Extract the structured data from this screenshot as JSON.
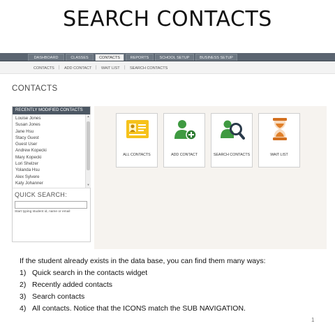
{
  "slide": {
    "title": "SEARCH CONTACTS",
    "page_number": "1"
  },
  "app": {
    "top_nav": [
      {
        "label": "DASHBOARD",
        "active": false
      },
      {
        "label": "CLASSES",
        "active": false
      },
      {
        "label": "CONTACTS",
        "active": true
      },
      {
        "label": "REPORTS",
        "active": false
      },
      {
        "label": "SCHOOL SETUP",
        "active": false
      },
      {
        "label": "BUSINESS SETUP",
        "active": false
      }
    ],
    "sub_nav": [
      "CONTACTS",
      "ADD CONTACT",
      "WAIT LIST",
      "SEARCH CONTACTS"
    ],
    "sub_nav_separator": "|",
    "page_heading": "CONTACTS",
    "sidebar": {
      "header": "RECENTLY MODIFIED CONTACTS",
      "contacts": [
        "Louise Jones",
        "Susan Jones",
        "Jane Hsu",
        "Stacy Guest",
        "Guest User",
        "Andrew Kopecki",
        "Mary Kopecki",
        "Lori Shelzer",
        "Yolanda Hsu",
        "Alex Sylvere",
        "Katy Johanner"
      ],
      "quick_search_label": "QUICK SEARCH:",
      "quick_search_value": "",
      "quick_search_hint": "Start typing student id, name or email"
    },
    "tiles": [
      {
        "label": "ALL CONTACTS",
        "icon": "id-card-icon"
      },
      {
        "label": "ADD CONTACT",
        "icon": "add-person-icon"
      },
      {
        "label": "SEARCH CONTACTS",
        "icon": "search-person-icon"
      },
      {
        "label": "WAIT LIST",
        "icon": "hourglass-icon"
      }
    ],
    "colors": {
      "nav_bar": "#5a6470",
      "sidebar_header": "#4c5763",
      "panel_bg": "#f6f3ef",
      "icon_yellow": "#f6c21b",
      "icon_green": "#3f9a41",
      "icon_orange": "#e0802a"
    }
  },
  "notes": {
    "intro": "If the student already exists in the data base, you can find them many ways:",
    "points": [
      {
        "num": "1)",
        "text": "Quick search in the contacts widget"
      },
      {
        "num": "2)",
        "text": "Recently added contacts"
      },
      {
        "num": "3)",
        "text": "Search contacts"
      },
      {
        "num": "4)",
        "text": "All contacts.  Notice that the ICONS match the SUB NAVIGATION."
      }
    ]
  }
}
